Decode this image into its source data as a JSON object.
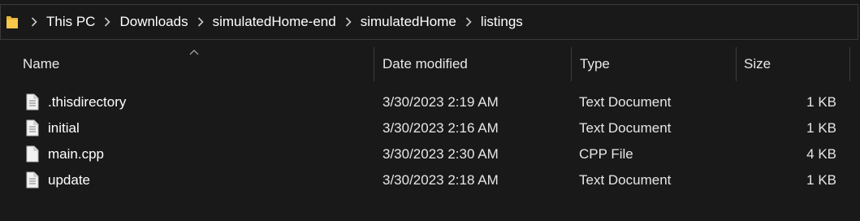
{
  "breadcrumb": {
    "items": [
      "This PC",
      "Downloads",
      "simulatedHome-end",
      "simulatedHome",
      "listings"
    ]
  },
  "columns": {
    "name": "Name",
    "date_modified": "Date modified",
    "type": "Type",
    "size": "Size"
  },
  "sort": {
    "column": "name",
    "direction": "ascending"
  },
  "files": [
    {
      "name": ".thisdirectory",
      "date_modified": "3/30/2023 2:19 AM",
      "type": "Text Document",
      "size": "1 KB",
      "icon": "text-file-icon"
    },
    {
      "name": "initial",
      "date_modified": "3/30/2023 2:16 AM",
      "type": "Text Document",
      "size": "1 KB",
      "icon": "text-file-icon"
    },
    {
      "name": "main.cpp",
      "date_modified": "3/30/2023 2:30 AM",
      "type": "CPP File",
      "size": "4 KB",
      "icon": "blank-file-icon"
    },
    {
      "name": "update",
      "date_modified": "3/30/2023 2:18 AM",
      "type": "Text Document",
      "size": "1 KB",
      "icon": "text-file-icon"
    }
  ],
  "colors": {
    "background": "#191919",
    "border": "#3a3a3a",
    "folder": "#f8c84a",
    "text": "#ffffff"
  }
}
